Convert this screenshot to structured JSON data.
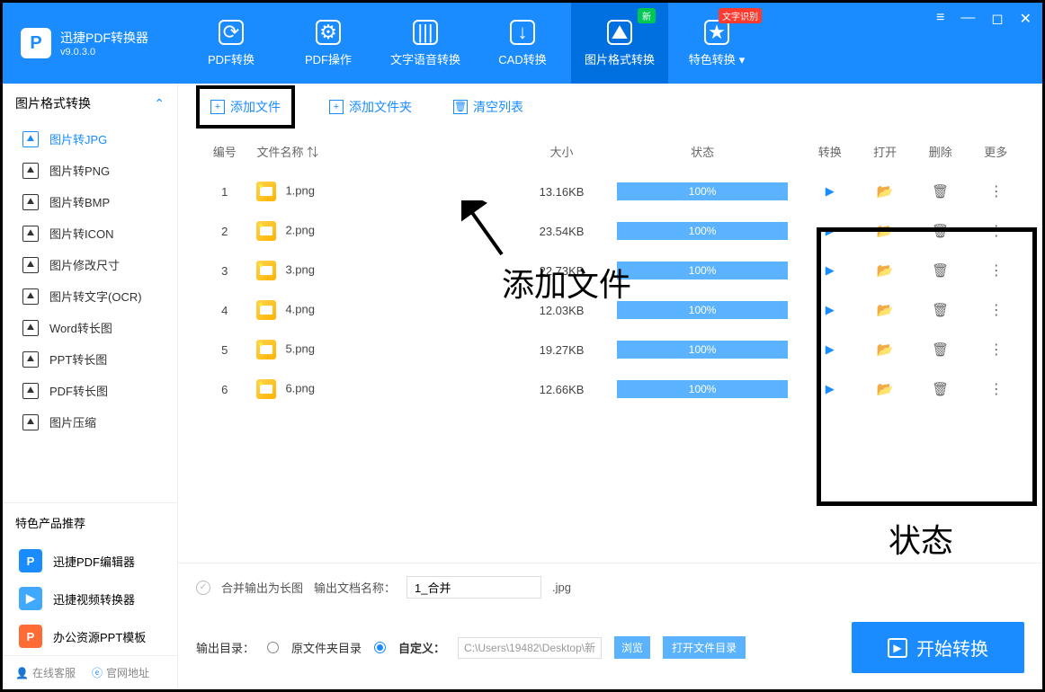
{
  "app": {
    "title": "迅捷PDF转换器",
    "version": "v9.0.3.0"
  },
  "nav": {
    "tabs": [
      {
        "label": "PDF转换",
        "glyph": "⟳"
      },
      {
        "label": "PDF操作",
        "glyph": "⚙"
      },
      {
        "label": "文字语音转换",
        "glyph": "|||"
      },
      {
        "label": "CAD转换",
        "glyph": "↓"
      },
      {
        "label": "图片格式转换",
        "glyph": "⛰",
        "badge": "新",
        "active": true
      },
      {
        "label": "特色转换",
        "glyph": "★",
        "badge": "文字识别",
        "badgeRed": true,
        "dropdown": true
      }
    ]
  },
  "sidebar": {
    "header": "图片格式转换",
    "items": [
      {
        "label": "图片转JPG",
        "active": true
      },
      {
        "label": "图片转PNG"
      },
      {
        "label": "图片转BMP"
      },
      {
        "label": "图片转ICON"
      },
      {
        "label": "图片修改尺寸"
      },
      {
        "label": "图片转文字(OCR)"
      },
      {
        "label": "Word转长图"
      },
      {
        "label": "PPT转长图"
      },
      {
        "label": "PDF转长图"
      },
      {
        "label": "图片压缩"
      }
    ],
    "recommend": {
      "header": "特色产品推荐",
      "items": [
        {
          "label": "迅捷PDF编辑器",
          "iconClass": "blue",
          "iconText": "P"
        },
        {
          "label": "迅捷视频转换器",
          "iconClass": "lightblue",
          "iconText": "▶"
        },
        {
          "label": "办公资源PPT模板",
          "iconClass": "orange",
          "iconText": "P"
        }
      ]
    },
    "footer": {
      "support": "在线客服",
      "website": "官网地址"
    }
  },
  "toolbar": {
    "addFile": "添加文件",
    "addFolder": "添加文件夹",
    "clearList": "清空列表"
  },
  "annotations": {
    "addFile": "添加文件",
    "status": "状态"
  },
  "table": {
    "headers": {
      "num": "编号",
      "name": "文件名称",
      "size": "大小",
      "status": "状态",
      "convert": "转换",
      "open": "打开",
      "delete": "删除",
      "more": "更多"
    },
    "rows": [
      {
        "num": "1",
        "name": "1.png",
        "size": "13.16KB",
        "progress": "100%"
      },
      {
        "num": "2",
        "name": "2.png",
        "size": "23.54KB",
        "progress": "100%"
      },
      {
        "num": "3",
        "name": "3.png",
        "size": "22.73KB",
        "progress": "100%"
      },
      {
        "num": "4",
        "name": "4.png",
        "size": "12.03KB",
        "progress": "100%"
      },
      {
        "num": "5",
        "name": "5.png",
        "size": "19.27KB",
        "progress": "100%"
      },
      {
        "num": "6",
        "name": "6.png",
        "size": "12.66KB",
        "progress": "100%"
      }
    ]
  },
  "bottom": {
    "mergeLabel": "合并输出为长图",
    "outNameLabel": "输出文档名称：",
    "outNameValue": "1_合并",
    "ext": ".jpg",
    "outDirLabel": "输出目录：",
    "origDir": "原文件夹目录",
    "custom": "自定义：",
    "customPath": "C:\\Users\\19482\\Desktop\\新",
    "browse": "浏览",
    "openDir": "打开文件目录",
    "start": "开始转换"
  }
}
